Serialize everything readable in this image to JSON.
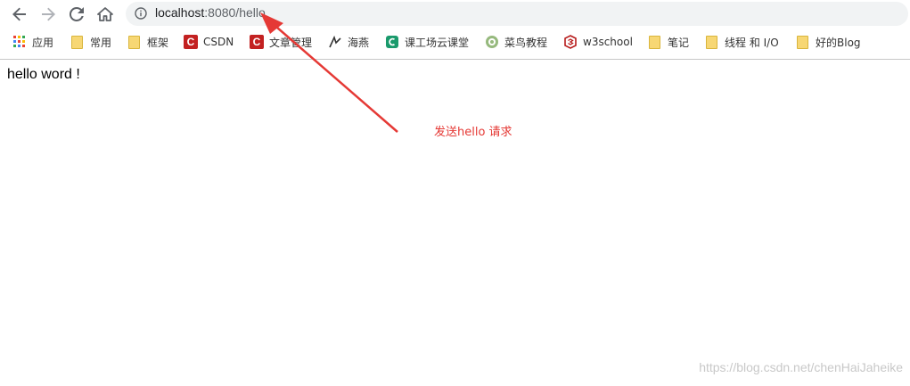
{
  "browser": {
    "url_host": "localhost",
    "url_rest": ":8080/hello",
    "nav": {
      "back": "back-icon",
      "forward": "forward-icon",
      "reload": "reload-icon",
      "home": "home-icon"
    }
  },
  "bookmarks": [
    {
      "label": "应用",
      "icon": "apps-icon"
    },
    {
      "label": "常用",
      "icon": "folder-icon"
    },
    {
      "label": "框架",
      "icon": "folder-icon"
    },
    {
      "label": "CSDN",
      "icon": "csdn-icon"
    },
    {
      "label": "文章管理",
      "icon": "csdn-icon"
    },
    {
      "label": "海燕",
      "icon": "haiyan-icon"
    },
    {
      "label": "课工场云课堂",
      "icon": "kgc-icon"
    },
    {
      "label": "菜鸟教程",
      "icon": "runoob-icon"
    },
    {
      "label": "w3school",
      "icon": "w3school-icon"
    },
    {
      "label": "笔记",
      "icon": "folder-icon"
    },
    {
      "label": "线程 和 I/O",
      "icon": "folder-icon"
    },
    {
      "label": "好的Blog",
      "icon": "folder-icon"
    }
  ],
  "page": {
    "body_text": "hello word !"
  },
  "annotation": {
    "text": "发送hello 请求",
    "color": "#e53935"
  },
  "watermark": "https://blog.csdn.net/chenHaiJaheike"
}
